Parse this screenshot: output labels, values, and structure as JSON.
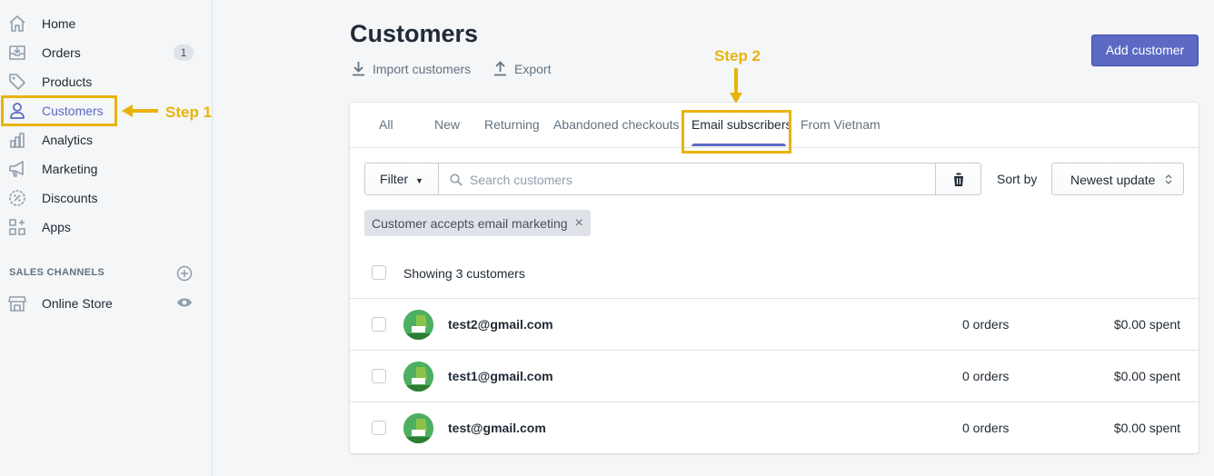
{
  "sidebar": {
    "items": [
      {
        "label": "Home",
        "icon": "home-icon"
      },
      {
        "label": "Orders",
        "icon": "orders-icon",
        "badge": "1"
      },
      {
        "label": "Products",
        "icon": "tag-icon"
      },
      {
        "label": "Customers",
        "icon": "person-icon",
        "active": true
      },
      {
        "label": "Analytics",
        "icon": "bar-chart-icon"
      },
      {
        "label": "Marketing",
        "icon": "megaphone-icon"
      },
      {
        "label": "Discounts",
        "icon": "discount-icon"
      },
      {
        "label": "Apps",
        "icon": "apps-icon"
      }
    ],
    "sales_channels_heading": "SALES CHANNELS",
    "online_store": "Online Store"
  },
  "annotations": {
    "step1": "Step 1",
    "step2": "Step 2",
    "color": "#e8b30c"
  },
  "page": {
    "title": "Customers",
    "import_label": "Import customers",
    "export_label": "Export",
    "add_button": "Add customer"
  },
  "tabs": [
    {
      "label": "All"
    },
    {
      "label": "New"
    },
    {
      "label": "Returning"
    },
    {
      "label": "Abandoned checkouts"
    },
    {
      "label": "Email subscribers",
      "active": true
    },
    {
      "label": "From Vietnam"
    }
  ],
  "filters": {
    "filter_label": "Filter",
    "search_placeholder": "Search customers",
    "sort_label": "Sort by",
    "sort_value": "Newest update",
    "applied_tag": "Customer accepts email marketing"
  },
  "list": {
    "summary": "Showing 3 customers",
    "rows": [
      {
        "email": "test2@gmail.com",
        "orders": "0 orders",
        "spent": "$0.00 spent"
      },
      {
        "email": "test1@gmail.com",
        "orders": "0 orders",
        "spent": "$0.00 spent"
      },
      {
        "email": "test@gmail.com",
        "orders": "0 orders",
        "spent": "$0.00 spent"
      }
    ]
  },
  "colors": {
    "accent": "#5c6ac4",
    "avatar": "#4caf61"
  }
}
